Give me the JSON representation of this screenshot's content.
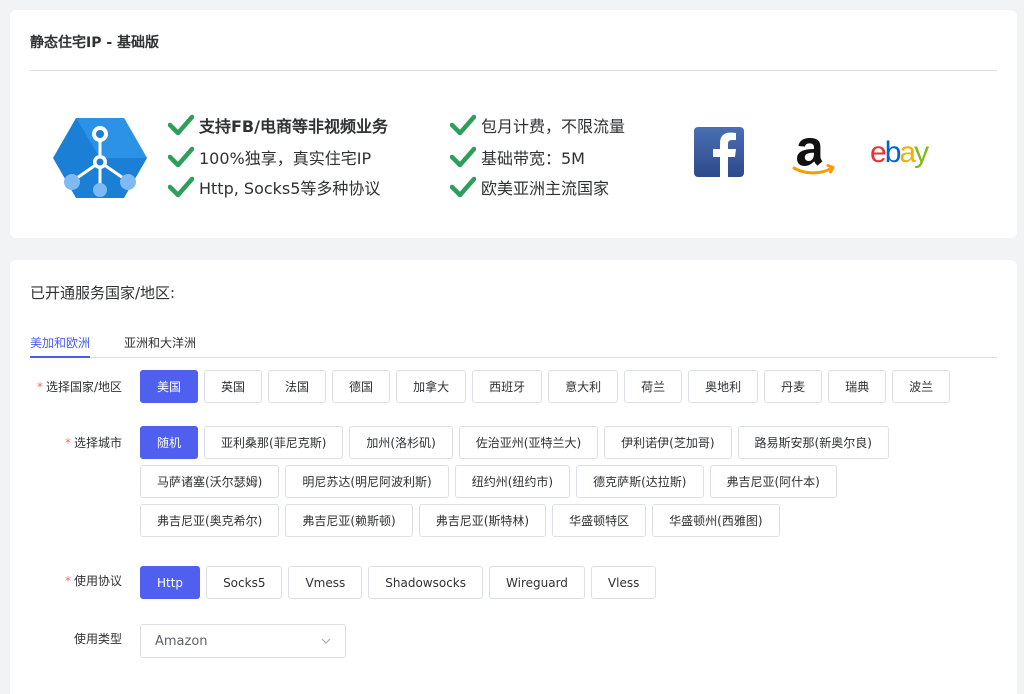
{
  "product": {
    "title": "静态住宅IP - 基础版",
    "features": [
      {
        "text": "支持FB/电商等非视频业务",
        "bold": true
      },
      {
        "text": "100%独享，真实住宅IP",
        "bold": false
      },
      {
        "text": "Http, Socks5等多种协议",
        "bold": false
      },
      {
        "text": "包月计费，不限流量",
        "bold": false
      },
      {
        "text": "基础带宽：5M",
        "bold": false
      },
      {
        "text": "欧美亚洲主流国家",
        "bold": false
      }
    ],
    "partners": {
      "facebook_icon": "facebook-logo",
      "amazon_icon": "amazon-logo",
      "ebay_letters": [
        "e",
        "b",
        "a",
        "y"
      ]
    },
    "colors": {
      "check": "#2e9e5b",
      "accent": "#4f5ff0",
      "required": "#f56c6c"
    }
  },
  "service": {
    "title": "已开通服务国家/地区:",
    "tabs": [
      {
        "label": "美加和欧洲",
        "active": true
      },
      {
        "label": "亚洲和大洋洲",
        "active": false
      }
    ],
    "country": {
      "label": "选择国家/地区",
      "required": "*",
      "options": [
        "美国",
        "英国",
        "法国",
        "德国",
        "加拿大",
        "西班牙",
        "意大利",
        "荷兰",
        "奥地利",
        "丹麦",
        "瑞典",
        "波兰"
      ],
      "selected": "美国"
    },
    "city": {
      "label": "选择城市",
      "required": "*",
      "options": [
        "随机",
        "亚利桑那(菲尼克斯)",
        "加州(洛杉矶)",
        "佐治亚州(亚特兰大)",
        "伊利诺伊(芝加哥)",
        "路易斯安那(新奥尔良)",
        "马萨诸塞(沃尔瑟姆)",
        "明尼苏达(明尼阿波利斯)",
        "纽约州(纽约市)",
        "德克萨斯(达拉斯)",
        "弗吉尼亚(阿什本)",
        "弗吉尼亚(奥克希尔)",
        "弗吉尼亚(赖斯顿)",
        "弗吉尼亚(斯特林)",
        "华盛顿特区",
        "华盛顿州(西雅图)"
      ],
      "selected": "随机"
    },
    "protocol": {
      "label": "使用协议",
      "required": "*",
      "options": [
        "Http",
        "Socks5",
        "Vmess",
        "Shadowsocks",
        "Wireguard",
        "Vless"
      ],
      "selected": "Http"
    },
    "usage": {
      "label": "使用类型",
      "value": "Amazon"
    }
  }
}
